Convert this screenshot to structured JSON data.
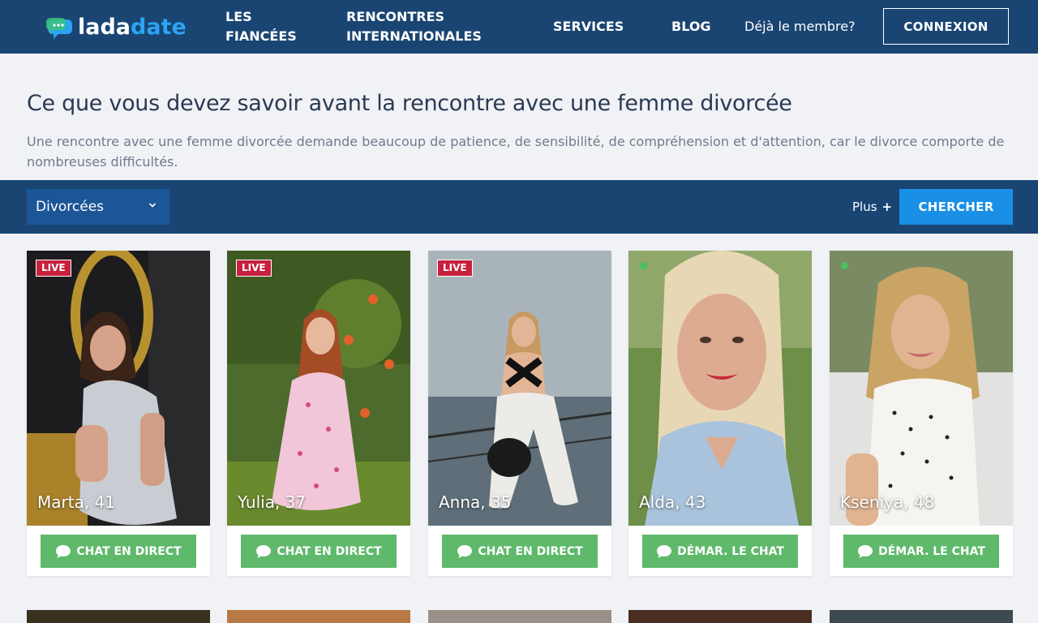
{
  "header": {
    "logo_part1": "lada",
    "logo_part2": "date",
    "nav": {
      "fiancees": "LES FIANCÉES",
      "international": "RENCONTRES INTERNATIONALES",
      "services": "SERVICES",
      "blog": "BLOG"
    },
    "member_text": "Déjà le membre?",
    "login_label": "CONNEXION"
  },
  "intro": {
    "title": "Ce que vous devez savoir avant la rencontre avec une femme divorcée",
    "subtitle": "Une rencontre avec une femme divorcée demande beaucoup de patience, de sensibilité, de compréhension et d'attention, car le divorce comporte de nombreuses difficultés."
  },
  "filters": {
    "selected": "Divorcées",
    "more_label": "Plus",
    "more_sign": "+",
    "search_label": "CHERCHER"
  },
  "profiles": [
    {
      "name": "Marta, 41",
      "badge": "LIVE",
      "button": "CHAT EN DIRECT"
    },
    {
      "name": "Yulia, 37",
      "badge": "LIVE",
      "button": "CHAT EN DIRECT"
    },
    {
      "name": "Anna, 35",
      "badge": "LIVE",
      "button": "CHAT EN DIRECT"
    },
    {
      "name": "Alda, 43",
      "badge": "",
      "button": "DÉMAR. LE CHAT"
    },
    {
      "name": "Kseniya, 48",
      "badge": "",
      "button": "DÉMAR. LE CHAT"
    }
  ],
  "colors": {
    "header_bg": "#1a4573",
    "accent_blue": "#1a8fe6",
    "chat_green": "#5fb96b",
    "live_red": "#c8203c"
  }
}
